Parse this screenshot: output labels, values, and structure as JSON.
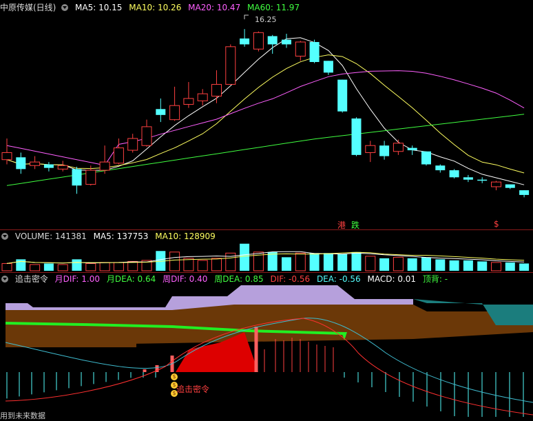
{
  "price_panel": {
    "title": "中原传媒(日线)",
    "ma5": "MA5: 10.15",
    "ma10": "MA10: 10.26",
    "ma20": "MA20: 10.47",
    "ma60": "MA60: 11.97",
    "high_label": "16.25",
    "tag_gang": "港",
    "tag_die": "跌",
    "tag_dollar": "$",
    "colors": {
      "ma5": "#ffffff",
      "ma10": "#ffff60",
      "ma20": "#ff60ff",
      "ma60": "#40ff40",
      "up": "#ff4040",
      "down": "#54ffff"
    }
  },
  "volume_panel": {
    "volume": "VOLUME: 141381",
    "ma5": "MA5: 137753",
    "ma10": "MA10: 128909"
  },
  "indicator_panel": {
    "name": "追击密令",
    "month_dif": "月DIF: 1.00",
    "month_dea": "月DEA: 0.64",
    "week_dif": "周DIF: 0.40",
    "week_dea": "周DEA: 0.85",
    "dif": "DIF: -0.56",
    "dea": "DEA: -0.56",
    "macd": "MACD: 0.01",
    "top_div": "顶背: -",
    "signal_label": "追击密令",
    "signal_coins": [
      "$",
      "$",
      "$"
    ]
  },
  "footer": {
    "text": "用到未来数据"
  },
  "chart_data": {
    "type": "candlestick",
    "high_marker": 16.25,
    "candles": [
      {
        "o": 11.0,
        "c": 10.7,
        "h": 11.6,
        "l": 10.5,
        "dir": "up"
      },
      {
        "o": 10.8,
        "c": 10.3,
        "h": 11.0,
        "l": 10.1,
        "dir": "down"
      },
      {
        "o": 10.45,
        "c": 10.6,
        "h": 10.85,
        "l": 10.3,
        "dir": "up"
      },
      {
        "o": 10.5,
        "c": 10.35,
        "h": 10.6,
        "l": 10.2,
        "dir": "down"
      },
      {
        "o": 10.3,
        "c": 10.45,
        "h": 10.65,
        "l": 10.2,
        "dir": "up"
      },
      {
        "o": 10.3,
        "c": 9.6,
        "h": 10.4,
        "l": 9.25,
        "dir": "down"
      },
      {
        "o": 9.65,
        "c": 10.25,
        "h": 10.45,
        "l": 9.6,
        "dir": "up"
      },
      {
        "o": 10.25,
        "c": 10.6,
        "h": 11.3,
        "l": 10.1,
        "dir": "up"
      },
      {
        "o": 10.55,
        "c": 11.2,
        "h": 11.6,
        "l": 10.5,
        "dir": "up"
      },
      {
        "o": 11.1,
        "c": 11.6,
        "h": 11.8,
        "l": 11.0,
        "dir": "up"
      },
      {
        "o": 11.3,
        "c": 12.1,
        "h": 12.4,
        "l": 11.25,
        "dir": "up"
      },
      {
        "o": 12.6,
        "c": 12.85,
        "h": 13.3,
        "l": 12.3,
        "dir": "down"
      },
      {
        "o": 12.4,
        "c": 13.0,
        "h": 13.8,
        "l": 12.35,
        "dir": "up"
      },
      {
        "o": 13.05,
        "c": 13.3,
        "h": 14.0,
        "l": 12.9,
        "dir": "up"
      },
      {
        "o": 13.2,
        "c": 13.5,
        "h": 13.7,
        "l": 13.0,
        "dir": "up"
      },
      {
        "o": 13.4,
        "c": 13.9,
        "h": 14.5,
        "l": 13.1,
        "dir": "up"
      },
      {
        "o": 13.9,
        "c": 15.5,
        "h": 15.6,
        "l": 13.9,
        "dir": "up"
      },
      {
        "o": 15.6,
        "c": 15.85,
        "h": 16.25,
        "l": 15.5,
        "dir": "down"
      },
      {
        "o": 15.4,
        "c": 16.1,
        "h": 16.15,
        "l": 15.3,
        "dir": "up"
      },
      {
        "o": 15.6,
        "c": 15.95,
        "h": 16.0,
        "l": 15.2,
        "dir": "down"
      },
      {
        "o": 15.6,
        "c": 15.8,
        "h": 16.05,
        "l": 15.45,
        "dir": "down"
      },
      {
        "o": 15.1,
        "c": 15.7,
        "h": 15.75,
        "l": 14.9,
        "dir": "up"
      },
      {
        "o": 15.7,
        "c": 14.85,
        "h": 15.8,
        "l": 14.8,
        "dir": "down"
      },
      {
        "o": 14.9,
        "c": 14.4,
        "h": 14.9,
        "l": 14.3,
        "dir": "down"
      },
      {
        "o": 14.1,
        "c": 12.75,
        "h": 14.1,
        "l": 12.7,
        "dir": "down"
      },
      {
        "o": 12.45,
        "c": 10.9,
        "h": 12.5,
        "l": 10.85,
        "dir": "down"
      },
      {
        "o": 11.0,
        "c": 11.3,
        "h": 11.5,
        "l": 10.6,
        "dir": "up"
      },
      {
        "o": 11.3,
        "c": 10.85,
        "h": 11.5,
        "l": 10.7,
        "dir": "down"
      },
      {
        "o": 11.05,
        "c": 11.4,
        "h": 11.55,
        "l": 10.9,
        "dir": "up"
      },
      {
        "o": 11.2,
        "c": 11.1,
        "h": 11.3,
        "l": 10.9,
        "dir": "down"
      },
      {
        "o": 11.05,
        "c": 10.5,
        "h": 11.05,
        "l": 10.45,
        "dir": "down"
      },
      {
        "o": 10.45,
        "c": 10.25,
        "h": 10.5,
        "l": 10.15,
        "dir": "down"
      },
      {
        "o": 10.25,
        "c": 9.95,
        "h": 10.3,
        "l": 9.9,
        "dir": "down"
      },
      {
        "o": 9.95,
        "c": 9.85,
        "h": 10.05,
        "l": 9.75,
        "dir": "down"
      },
      {
        "o": 9.85,
        "c": 9.85,
        "h": 9.95,
        "l": 9.7,
        "dir": "down"
      },
      {
        "o": 9.55,
        "c": 9.75,
        "h": 9.8,
        "l": 9.4,
        "dir": "up"
      },
      {
        "o": 9.65,
        "c": 9.5,
        "h": 9.65,
        "l": 9.45,
        "dir": "down"
      },
      {
        "o": 9.4,
        "c": 9.2,
        "h": 9.4,
        "l": 9.1,
        "dir": "down"
      }
    ],
    "volumes": [
      {
        "v": 0.35,
        "dir": "up"
      },
      {
        "v": 0.55,
        "dir": "down"
      },
      {
        "v": 0.3,
        "dir": "up"
      },
      {
        "v": 0.35,
        "dir": "down"
      },
      {
        "v": 0.3,
        "dir": "up"
      },
      {
        "v": 0.55,
        "dir": "down"
      },
      {
        "v": 0.35,
        "dir": "up"
      },
      {
        "v": 0.4,
        "dir": "up"
      },
      {
        "v": 0.4,
        "dir": "up"
      },
      {
        "v": 0.45,
        "dir": "up"
      },
      {
        "v": 0.5,
        "dir": "up"
      },
      {
        "v": 0.95,
        "dir": "down"
      },
      {
        "v": 0.9,
        "dir": "up"
      },
      {
        "v": 0.6,
        "dir": "up"
      },
      {
        "v": 0.5,
        "dir": "up"
      },
      {
        "v": 0.6,
        "dir": "up"
      },
      {
        "v": 0.85,
        "dir": "up"
      },
      {
        "v": 1.3,
        "dir": "down"
      },
      {
        "v": 0.9,
        "dir": "up"
      },
      {
        "v": 0.9,
        "dir": "down"
      },
      {
        "v": 0.65,
        "dir": "down"
      },
      {
        "v": 0.85,
        "dir": "up"
      },
      {
        "v": 0.85,
        "dir": "down"
      },
      {
        "v": 0.85,
        "dir": "down"
      },
      {
        "v": 0.8,
        "dir": "down"
      },
      {
        "v": 0.9,
        "dir": "down"
      },
      {
        "v": 0.7,
        "dir": "up"
      },
      {
        "v": 0.6,
        "dir": "down"
      },
      {
        "v": 0.65,
        "dir": "up"
      },
      {
        "v": 0.6,
        "dir": "down"
      },
      {
        "v": 0.65,
        "dir": "down"
      },
      {
        "v": 0.55,
        "dir": "down"
      },
      {
        "v": 0.5,
        "dir": "down"
      },
      {
        "v": 0.5,
        "dir": "down"
      },
      {
        "v": 0.45,
        "dir": "down"
      },
      {
        "v": 0.4,
        "dir": "up"
      },
      {
        "v": 0.4,
        "dir": "down"
      },
      {
        "v": 0.35,
        "dir": "down"
      }
    ],
    "price_range": [
      8.7,
      16.9
    ]
  }
}
